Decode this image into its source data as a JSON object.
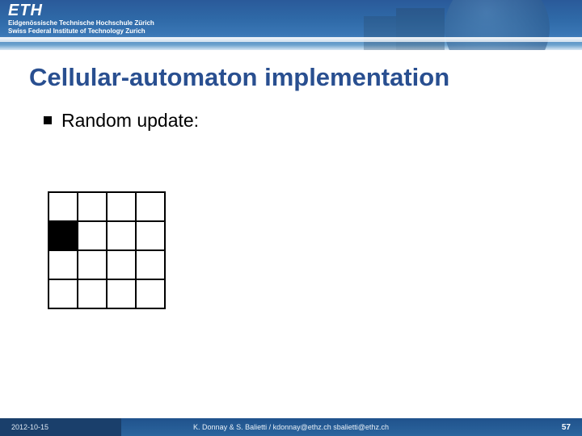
{
  "header": {
    "logo_text": "ETH",
    "tagline1": "Eidgenössische Technische Hochschule Zürich",
    "tagline2": "Swiss Federal Institute of Technology Zurich"
  },
  "title": "Cellular-automaton implementation",
  "bullet": "Random update:",
  "grid": {
    "rows": 4,
    "cols": 4,
    "filled": [
      [
        1,
        0
      ]
    ]
  },
  "footer": {
    "date": "2012-10-15",
    "credits": "K. Donnay & S. Balietti / kdonnay@ethz.ch   sbalietti@ethz.ch",
    "page": "57"
  }
}
